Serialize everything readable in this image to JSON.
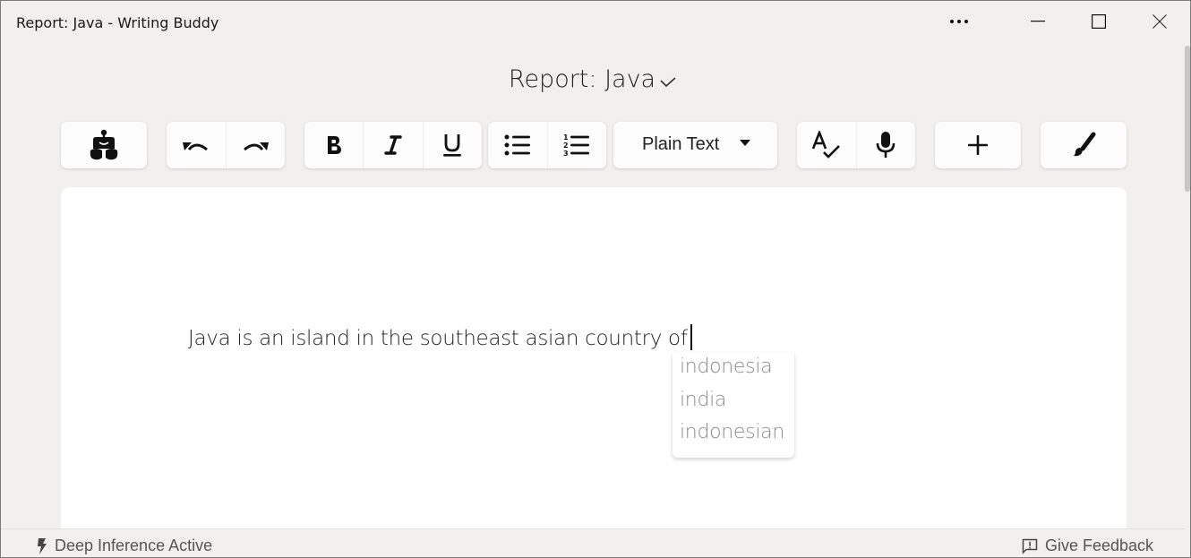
{
  "window": {
    "title": "Report: Java - Writing Buddy",
    "controls": {
      "more": "more-options",
      "minimize": "minimize",
      "maximize": "maximize",
      "close": "close"
    }
  },
  "document": {
    "title": "Report: Java",
    "saved_indicator": "checkmark"
  },
  "toolbar": {
    "groups": [
      {
        "name": "logo",
        "buttons": [
          {
            "icon": "robot-icon",
            "label": "Writing Buddy"
          }
        ]
      },
      {
        "name": "history",
        "buttons": [
          {
            "icon": "undo-icon",
            "label": "Undo"
          },
          {
            "icon": "redo-icon",
            "label": "Redo"
          }
        ]
      },
      {
        "name": "format",
        "buttons": [
          {
            "icon": "bold-icon",
            "label": "Bold"
          },
          {
            "icon": "italic-icon",
            "label": "Italic"
          },
          {
            "icon": "underline-icon",
            "label": "Underline"
          }
        ]
      },
      {
        "name": "lists",
        "buttons": [
          {
            "icon": "bulleted-list-icon",
            "label": "Bulleted List"
          },
          {
            "icon": "numbered-list-icon",
            "label": "Numbered List"
          }
        ]
      },
      {
        "name": "tools",
        "buttons": [
          {
            "icon": "spellcheck-icon",
            "label": "Spell Check"
          },
          {
            "icon": "microphone-icon",
            "label": "Dictation"
          }
        ]
      },
      {
        "name": "insert",
        "buttons": [
          {
            "icon": "plus-icon",
            "label": "Add"
          }
        ]
      },
      {
        "name": "style",
        "buttons": [
          {
            "icon": "brush-icon",
            "label": "Style"
          }
        ]
      }
    ],
    "text_style_select": {
      "selected": "Plain Text"
    }
  },
  "editor": {
    "text": "Java is an island in the southeast asian country of",
    "suggestions": [
      "indonesia",
      "india",
      "indonesian"
    ]
  },
  "statusbar": {
    "left": {
      "icon": "lightning-icon",
      "label": "Deep Inference Active"
    },
    "right": {
      "icon": "feedback-icon",
      "label": "Give Feedback"
    }
  }
}
